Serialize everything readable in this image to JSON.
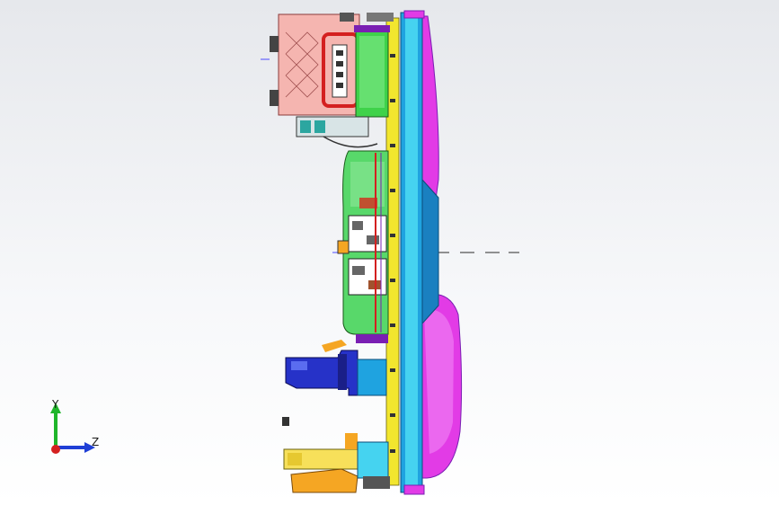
{
  "viewport": {
    "background_top": "#e6e8ec",
    "background_bottom": "#ffffff",
    "colors": {
      "magenta_panel": "#e23be6",
      "blue_frame": "#1fa3e0",
      "cyan_frame": "#45d3f0",
      "yellow_rail": "#f2e62e",
      "green_body": "#3fd24a",
      "pink_housing": "#f5b5b0",
      "red_outline": "#d42020",
      "navy_bracket": "#2632c8",
      "orange_bracket": "#f5a623",
      "yellow_bracket": "#f7e05a",
      "purple_accent": "#7a1fb3"
    }
  },
  "triad": {
    "y_label": "Y",
    "z_label": "Z",
    "y_color": "#1fb52a",
    "z_color": "#1f3fd6",
    "origin_color": "#d42020"
  }
}
